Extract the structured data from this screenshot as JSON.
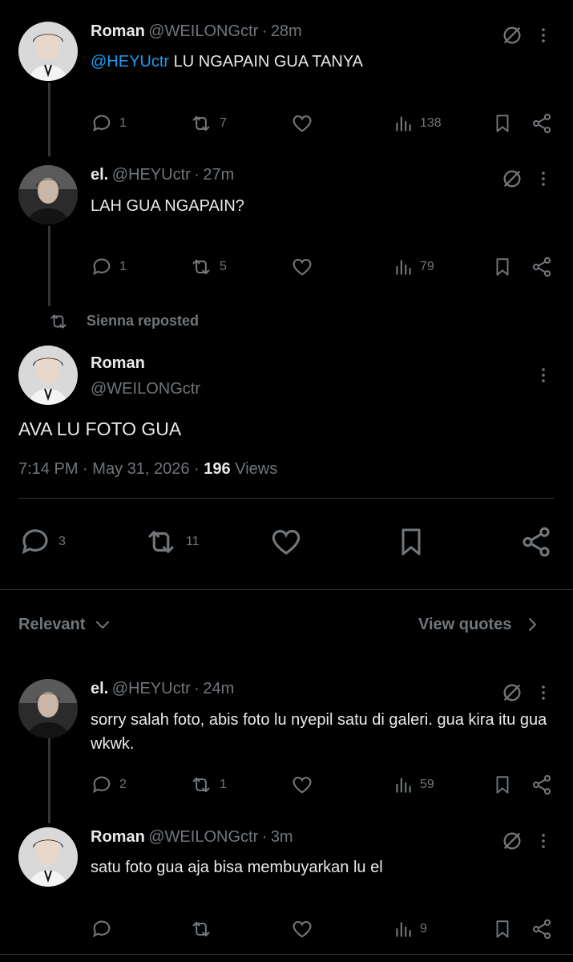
{
  "reply1": {
    "name": "Roman",
    "handle": "@WEILONGctr",
    "time": "28m",
    "mention": "@HEYUctr",
    "text": "LU NGAPAIN GUA TANYA",
    "replies": "1",
    "reposts": "7",
    "views": "138"
  },
  "reply2": {
    "name": "el.",
    "handle": "@HEYUctr",
    "time": "27m",
    "text": "LAH GUA NGAPAIN?",
    "replies": "1",
    "reposts": "5",
    "views": "79"
  },
  "repost_banner": {
    "text": "Sienna reposted"
  },
  "main": {
    "name": "Roman",
    "handle": "@WEILONGctr",
    "text": "AVA LU FOTO GUA",
    "time": "7:14 PM",
    "date": "May 31, 2026",
    "views_count": "196",
    "views_label": "Views",
    "replies": "3",
    "reposts": "11"
  },
  "sort": {
    "label": "Relevant",
    "quotes_label": "View quotes"
  },
  "reply3": {
    "name": "el.",
    "handle": "@HEYUctr",
    "time": "24m",
    "text": "sorry salah foto, abis foto lu nyepil satu di galeri. gua kira itu gua wkwk.",
    "replies": "2",
    "reposts": "1",
    "views": "59"
  },
  "reply4": {
    "name": "Roman",
    "handle": "@WEILONGctr",
    "time": "3m",
    "text": "satu foto gua aja bisa membuyarkan lu el",
    "views": "9"
  },
  "colors": {
    "background": "#000000",
    "text": "#e7e9ea",
    "muted": "#71767b",
    "link": "#1d9bf0"
  }
}
